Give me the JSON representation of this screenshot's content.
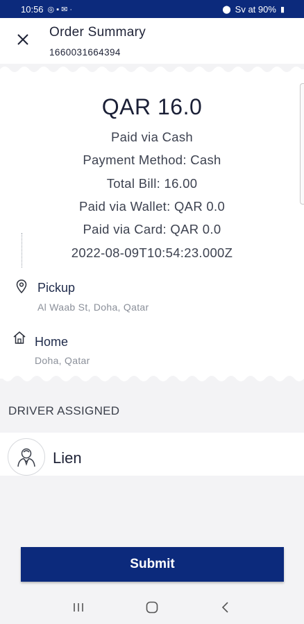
{
  "status_bar": {
    "time": "10:56",
    "right_text": "Sv at 90%"
  },
  "header": {
    "title": "Order Summary",
    "order_id": "1660031664394"
  },
  "receipt": {
    "amount": "QAR 16.0",
    "lines": [
      "Paid via Cash",
      "Payment Method: Cash",
      "Total Bill: 16.00",
      "Paid via Wallet: QAR 0.0",
      "Paid via Card: QAR 0.0",
      "2022-08-09T10:54:23.000Z"
    ],
    "pickup": {
      "title": "Pickup",
      "address": "Al Waab St, Doha, Qatar"
    },
    "dropoff": {
      "title": "Home",
      "address": "Doha, Qatar"
    }
  },
  "driver": {
    "heading": "DRIVER ASSIGNED",
    "name": "Lien"
  },
  "actions": {
    "submit_label": "Submit"
  },
  "colors": {
    "primary": "#0c2a7c",
    "background": "#f3f3f5",
    "card": "#ffffff"
  },
  "icons": {
    "close": "close-icon",
    "pickup": "location-pin-icon",
    "dropoff": "home-icon",
    "avatar": "person-icon",
    "nav_recents": "recents-icon",
    "nav_home": "home-circle-icon",
    "nav_back": "back-icon"
  }
}
